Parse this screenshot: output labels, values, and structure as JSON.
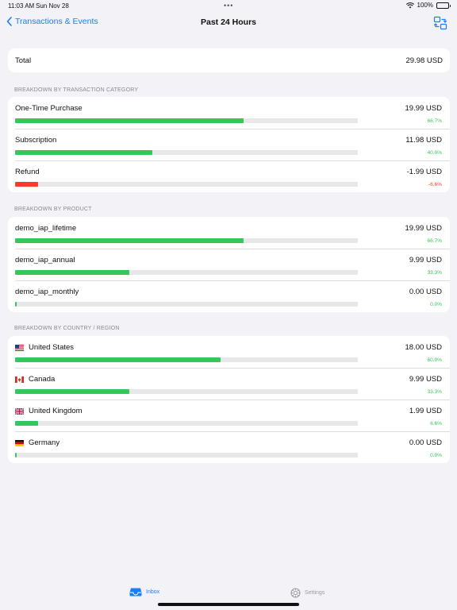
{
  "status": {
    "time": "11:03 AM",
    "date": "Sun Nov 28",
    "dots": "•••",
    "battery": "100%"
  },
  "nav": {
    "back_label": "Transactions & Events",
    "title": "Past 24 Hours"
  },
  "total": {
    "label": "Total",
    "amount": "29.98 USD"
  },
  "sections": {
    "category": {
      "header": "BREAKDOWN BY TRANSACTION CATEGORY",
      "rows": [
        {
          "label": "One-Time Purchase",
          "amount": "19.99 USD",
          "percent": "66.7%",
          "fraction": 0.667,
          "negative": false
        },
        {
          "label": "Subscription",
          "amount": "11.98 USD",
          "percent": "40.0%",
          "fraction": 0.4,
          "negative": false
        },
        {
          "label": "Refund",
          "amount": "-1.99 USD",
          "percent": "-6.6%",
          "fraction": 0.066,
          "negative": true
        }
      ]
    },
    "product": {
      "header": "BREAKDOWN BY PRODUCT",
      "rows": [
        {
          "label": "demo_iap_lifetime",
          "amount": "19.99 USD",
          "percent": "66.7%",
          "fraction": 0.667,
          "negative": false
        },
        {
          "label": "demo_iap_annual",
          "amount": "9.99 USD",
          "percent": "33.3%",
          "fraction": 0.333,
          "negative": false
        },
        {
          "label": "demo_iap_monthly",
          "amount": "0.00 USD",
          "percent": "0.0%",
          "fraction": 0.0,
          "negative": false
        }
      ]
    },
    "country": {
      "header": "BREAKDOWN BY COUNTRY / REGION",
      "rows": [
        {
          "label": "United States",
          "flag": "us-flag-icon",
          "amount": "18.00 USD",
          "percent": "60.0%",
          "fraction": 0.6,
          "negative": false
        },
        {
          "label": "Canada",
          "flag": "canada-flag-icon",
          "amount": "9.99 USD",
          "percent": "33.3%",
          "fraction": 0.333,
          "negative": false
        },
        {
          "label": "United Kingdom",
          "flag": "uk-flag-icon",
          "amount": "1.99 USD",
          "percent": "6.6%",
          "fraction": 0.066,
          "negative": false
        },
        {
          "label": "Germany",
          "flag": "germany-flag-icon",
          "amount": "0.00 USD",
          "percent": "0.0%",
          "fraction": 0.0,
          "negative": false
        }
      ]
    }
  },
  "tabs": {
    "inbox": "Inbox",
    "settings": "Settings"
  },
  "colors": {
    "accent": "#1a7ff5",
    "positive": "#35c759",
    "negative": "#ff3b30",
    "track": "#e7e7ea"
  }
}
